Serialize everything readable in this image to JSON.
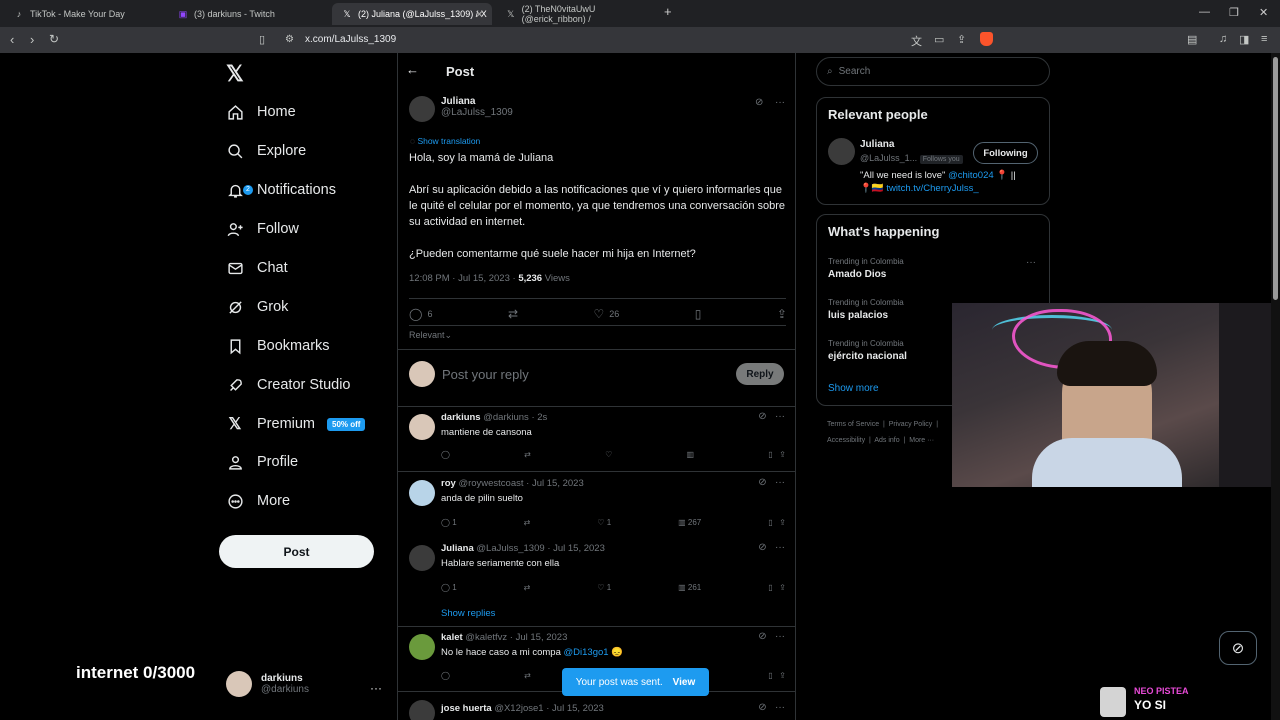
{
  "browser": {
    "tabs": [
      {
        "title": "TikTok - Make Your Day",
        "icon": "tiktok-icon"
      },
      {
        "title": "(3) darkiuns - Twitch",
        "icon": "twitch-icon"
      },
      {
        "title": "(2) Juliana (@LaJulss_1309) / X",
        "icon": "x-icon"
      },
      {
        "title": "(2) TheN0vitaUwU (@erick_ribbon) /",
        "icon": "x-icon"
      }
    ],
    "url": "x.com/LaJulss_1309"
  },
  "nav": {
    "items": [
      {
        "label": "Home",
        "icon": "home-icon"
      },
      {
        "label": "Explore",
        "icon": "search-icon"
      },
      {
        "label": "Notifications",
        "icon": "bell-icon",
        "badge": "2"
      },
      {
        "label": "Follow",
        "icon": "person-add-icon"
      },
      {
        "label": "Chat",
        "icon": "mail-icon"
      },
      {
        "label": "Grok",
        "icon": "grok-icon"
      },
      {
        "label": "Bookmarks",
        "icon": "bookmark-icon"
      },
      {
        "label": "Creator Studio",
        "icon": "rocket-icon"
      },
      {
        "label": "Premium",
        "icon": "x-icon",
        "promo": "50% off"
      },
      {
        "label": "Profile",
        "icon": "person-icon"
      },
      {
        "label": "More",
        "icon": "more-circle-icon"
      }
    ],
    "post_button": "Post",
    "account": {
      "name": "darkiuns",
      "handle": "@darkiuns"
    }
  },
  "overlay": {
    "text": "internet  0/3000"
  },
  "post": {
    "header": "Post",
    "author_name": "Juliana",
    "author_handle": "@LaJulss_1309",
    "show_translation": "Show translation",
    "p1": "Hola, soy la mamá de Juliana",
    "p2": "Abrí su aplicación debido a las notificaciones que ví y quiero informarles que le quité el celular por el momento, ya que tendremos una conversación sobre su actividad en internet.",
    "p3": "¿Pueden comentarme qué suele hacer mi hija en Internet?",
    "time": "12:08 PM · Jul 15, 2023 ·",
    "views_count": "5,236",
    "views_label": "Views",
    "replies": "6",
    "likes": "26",
    "sort": "Relevant",
    "reply_placeholder": "Post your reply",
    "reply_button": "Reply"
  },
  "comments": [
    {
      "name": "darkiuns",
      "handle": "@darkiuns",
      "time": "· 2s",
      "text": "mantiene de cansona",
      "replies": "",
      "likes": "",
      "views": ""
    },
    {
      "name": "roy",
      "handle": "@roywestcoast",
      "time": "· Jul 15, 2023",
      "text": "anda de pilin suelto",
      "replies": "1",
      "likes": "1",
      "views": "267"
    },
    {
      "name": "Juliana",
      "handle": "@LaJulss_1309",
      "time": "· Jul 15, 2023",
      "text": "Hablare seriamente con ella",
      "replies": "1",
      "likes": "1",
      "views": "261",
      "show_replies": "Show replies"
    },
    {
      "name": "kalet",
      "handle": "@kaletfvz",
      "time": "· Jul 15, 2023",
      "text": "No le hace caso a mi compa ",
      "mention": "@Di13go1",
      "emoji": "😞"
    },
    {
      "name": "jose huerta",
      "handle": "@X12jose1",
      "time": "· Jul 15, 2023"
    }
  ],
  "toast": {
    "text": "Your post was sent.",
    "action": "View"
  },
  "sidebar": {
    "search_placeholder": "Search",
    "relevant_title": "Relevant people",
    "person": {
      "name": "Juliana",
      "handle": "@LaJulss_1...",
      "follows_you": "Follows you",
      "follow_button": "Following",
      "bio1": "\"All we need is love\"",
      "bio_mention": "@chito024",
      "bio1_tail": "📍 ||",
      "bio2_prefix": "📍🇨🇴",
      "bio_link": "twitch.tv/CherryJulss_"
    },
    "happening_title": "What's happening",
    "trends": [
      {
        "label": "Trending in Colombia",
        "topic": "Amado Dios"
      },
      {
        "label": "Trending in Colombia",
        "topic": "luis palacios"
      },
      {
        "label": "Trending in Colombia",
        "topic": "ejército nacional"
      }
    ],
    "show_more": "Show more",
    "footer": [
      "Terms of Service",
      "Privacy Policy",
      "Accessibility",
      "Ads info",
      "More ···"
    ]
  },
  "stream": {
    "neo_label": "NEO PISTEA",
    "neo_text": "YO SI"
  },
  "colors": {
    "accent": "#1d9bf0",
    "background": "#000000",
    "border": "#2f3336",
    "muted": "#71767b"
  }
}
